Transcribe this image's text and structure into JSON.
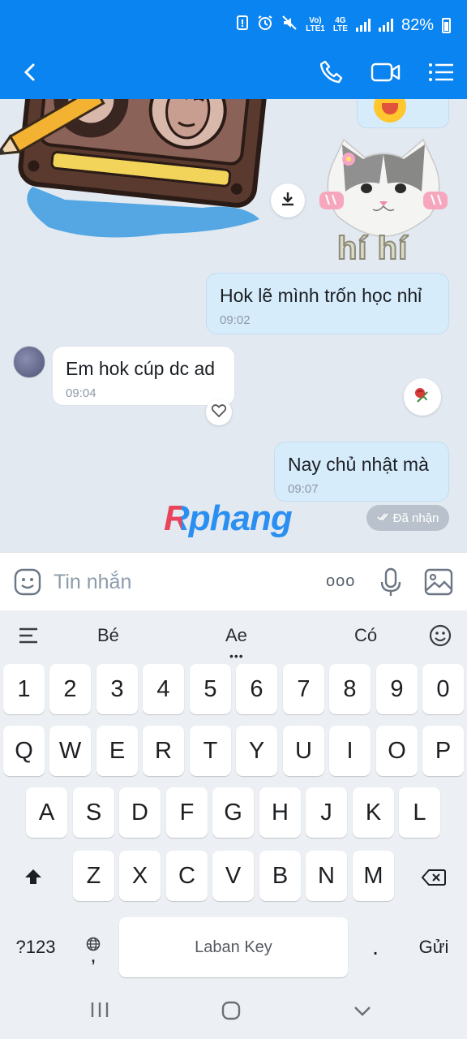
{
  "status_bar": {
    "volte_top": "Vo)",
    "volte_bottom": "LTE1",
    "net_top": "4G",
    "net_bottom": "LTE",
    "battery": "82%"
  },
  "header": {
    "icons": [
      "back-arrow-icon",
      "phone-icon",
      "video-call-icon",
      "menu-list-icon"
    ]
  },
  "chat": {
    "sticker_caption": "hí hí",
    "messages": [
      {
        "direction": "out",
        "text": "Hok lẽ mình trốn học nhỉ",
        "time": "09:02"
      },
      {
        "direction": "in",
        "text": "Em hok cúp dc ad",
        "time": "09:04"
      },
      {
        "direction": "out",
        "text": "Nay chủ nhật mà",
        "time": "09:07"
      }
    ],
    "watermark": "Rphang",
    "seen_status": "Đã nhận"
  },
  "composer": {
    "placeholder": "Tin nhắn",
    "more_glyph": "ooo"
  },
  "keyboard": {
    "suggestions": [
      "Bé",
      "Ae",
      "Có"
    ],
    "rows": [
      [
        "1",
        "2",
        "3",
        "4",
        "5",
        "6",
        "7",
        "8",
        "9",
        "0"
      ],
      [
        "Q",
        "W",
        "E",
        "R",
        "T",
        "Y",
        "U",
        "I",
        "O",
        "P"
      ],
      [
        "A",
        "S",
        "D",
        "F",
        "G",
        "H",
        "J",
        "K",
        "L"
      ],
      [
        "Z",
        "X",
        "C",
        "V",
        "B",
        "N",
        "M"
      ]
    ],
    "symbols_key": "?123",
    "comma_key": ",",
    "space_label": "Laban Key",
    "period_key": ".",
    "send_key": "Gửi"
  },
  "colors": {
    "header": "#0a84f0",
    "chat_bg": "#e2e9f1",
    "bubble_out": "#d7ecfb",
    "bubble_in": "#ffffff",
    "watermark_red": "#e8455a",
    "watermark_blue": "#2a8ff0"
  }
}
